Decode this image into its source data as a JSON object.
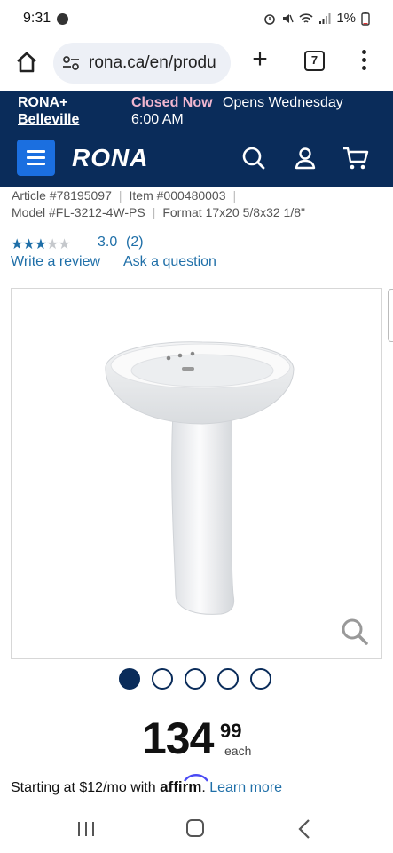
{
  "status_bar": {
    "time": "9:31",
    "battery": "1%",
    "icons": [
      "alarm-icon",
      "mute-icon",
      "wifi-icon",
      "signal-icon",
      "battery-icon"
    ]
  },
  "browser": {
    "url": "rona.ca/en/produ",
    "tab_count": "7",
    "plus_label": "+"
  },
  "store": {
    "name_line1": "RONA+",
    "name_line2": "Belleville",
    "status": "Closed Now",
    "opens_text": "Opens Wednesday",
    "opens_time": "6:00 AM"
  },
  "header": {
    "logo_text": "RONA",
    "brand_color": "#0a2c5a",
    "accent_color": "#1b6fe0"
  },
  "product": {
    "article_label": "Article #78195097",
    "item_label": "Item #000480003",
    "model_label": "Model #FL-3212-4W-PS",
    "format_label": "Format 17x20 5/8x32 1/8\"",
    "rating": 3.0,
    "rating_display": "3.0",
    "rating_count": "(2)",
    "stars_filled": 3,
    "stars_total": 5,
    "write_review": "Write a review",
    "ask_question": "Ask a question",
    "image_count": 5,
    "active_image": 1,
    "price_dollars": "134",
    "price_cents": "99",
    "price_unit": "each",
    "financing_prefix": "Starting at $12/mo with ",
    "financing_brand": "affirm",
    "financing_suffix": ". ",
    "learn_more": "Learn more"
  }
}
